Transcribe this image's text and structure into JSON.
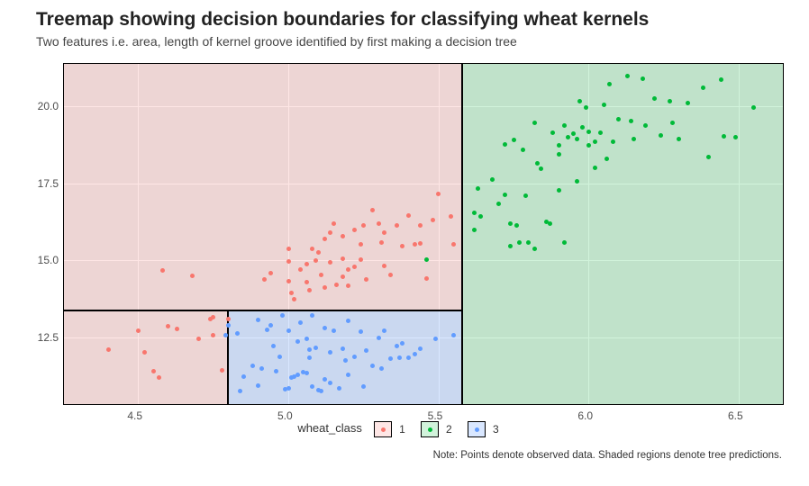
{
  "chart_data": {
    "type": "scatter",
    "title": "Treemap showing decision boundaries for classifying wheat kernels",
    "subtitle": "Two features i.e. area, length of kernel groove identified by first making a decision tree",
    "xlabel": "",
    "ylabel": "",
    "legend_title": "wheat_class",
    "legend_items": [
      "1",
      "2",
      "3"
    ],
    "caption": "Note: Points denote observed data. Shaded regions denote tree predictions.",
    "xlim": [
      4.25,
      6.65
    ],
    "ylim": [
      10.3,
      21.4
    ],
    "xticks": [
      4.5,
      5.0,
      5.5,
      6.0,
      6.5
    ],
    "yticks": [
      12.5,
      15.0,
      17.5,
      20.0
    ],
    "regions": [
      {
        "class": 2,
        "xmin": 5.58,
        "xmax": 6.65,
        "ymin": 10.3,
        "ymax": 21.4
      },
      {
        "class": 1,
        "xmin": 4.25,
        "xmax": 5.58,
        "ymin": 13.38,
        "ymax": 21.4
      },
      {
        "class": 1,
        "xmin": 4.25,
        "xmax": 4.8,
        "ymin": 10.3,
        "ymax": 13.38
      },
      {
        "class": 3,
        "xmin": 4.8,
        "xmax": 5.58,
        "ymin": 10.3,
        "ymax": 13.38
      }
    ],
    "series": [
      {
        "name": "1",
        "class": 1,
        "points": [
          [
            4.4,
            12.1
          ],
          [
            4.52,
            12.0
          ],
          [
            4.55,
            11.41
          ],
          [
            4.5,
            12.7
          ],
          [
            4.57,
            11.2
          ],
          [
            4.6,
            12.85
          ],
          [
            4.63,
            12.78
          ],
          [
            4.7,
            12.45
          ],
          [
            4.74,
            13.1
          ],
          [
            4.75,
            12.55
          ],
          [
            4.75,
            13.15
          ],
          [
            4.58,
            14.66
          ],
          [
            4.68,
            14.49
          ],
          [
            4.8,
            13.1
          ],
          [
            4.78,
            11.42
          ],
          [
            4.92,
            14.38
          ],
          [
            4.94,
            14.57
          ],
          [
            5.0,
            14.95
          ],
          [
            5.0,
            14.33
          ],
          [
            5.0,
            15.36
          ],
          [
            5.01,
            13.94
          ],
          [
            5.02,
            13.74
          ],
          [
            5.04,
            14.7
          ],
          [
            5.06,
            14.88
          ],
          [
            5.06,
            14.29
          ],
          [
            5.07,
            14.03
          ],
          [
            5.08,
            15.38
          ],
          [
            5.09,
            14.99
          ],
          [
            5.1,
            15.26
          ],
          [
            5.11,
            14.52
          ],
          [
            5.12,
            14.11
          ],
          [
            5.12,
            15.69
          ],
          [
            5.14,
            15.88
          ],
          [
            5.14,
            14.92
          ],
          [
            5.15,
            16.19
          ],
          [
            5.16,
            14.21
          ],
          [
            5.18,
            15.78
          ],
          [
            5.18,
            15.05
          ],
          [
            5.18,
            14.46
          ],
          [
            5.2,
            14.16
          ],
          [
            5.2,
            14.69
          ],
          [
            5.22,
            15.99
          ],
          [
            5.22,
            14.79
          ],
          [
            5.24,
            15.51
          ],
          [
            5.24,
            15.01
          ],
          [
            5.25,
            16.12
          ],
          [
            5.26,
            14.38
          ],
          [
            5.28,
            16.63
          ],
          [
            5.3,
            16.2
          ],
          [
            5.31,
            15.56
          ],
          [
            5.32,
            14.8
          ],
          [
            5.32,
            15.9
          ],
          [
            5.34,
            14.52
          ],
          [
            5.36,
            16.14
          ],
          [
            5.38,
            15.46
          ],
          [
            5.4,
            16.44
          ],
          [
            5.42,
            15.5
          ],
          [
            5.44,
            16.12
          ],
          [
            5.44,
            15.55
          ],
          [
            5.46,
            14.4
          ],
          [
            5.48,
            16.31
          ],
          [
            5.5,
            17.14
          ],
          [
            5.54,
            16.41
          ],
          [
            5.55,
            15.5
          ]
        ]
      },
      {
        "name": "2",
        "class": 2,
        "points": [
          [
            5.46,
            15.03
          ],
          [
            5.62,
            16.53
          ],
          [
            5.64,
            16.41
          ],
          [
            5.62,
            15.99
          ],
          [
            5.63,
            17.32
          ],
          [
            5.68,
            17.63
          ],
          [
            5.7,
            16.82
          ],
          [
            5.72,
            18.76
          ],
          [
            5.72,
            17.12
          ],
          [
            5.74,
            15.46
          ],
          [
            5.74,
            16.2
          ],
          [
            5.75,
            18.89
          ],
          [
            5.76,
            16.12
          ],
          [
            5.77,
            15.56
          ],
          [
            5.78,
            18.59
          ],
          [
            5.79,
            17.08
          ],
          [
            5.8,
            15.57
          ],
          [
            5.82,
            15.38
          ],
          [
            5.82,
            19.46
          ],
          [
            5.83,
            18.14
          ],
          [
            5.84,
            17.98
          ],
          [
            5.86,
            16.23
          ],
          [
            5.87,
            16.19
          ],
          [
            5.88,
            19.14
          ],
          [
            5.9,
            18.72
          ],
          [
            5.9,
            18.43
          ],
          [
            5.9,
            17.26
          ],
          [
            5.92,
            19.38
          ],
          [
            5.92,
            15.56
          ],
          [
            5.93,
            18.98
          ],
          [
            5.95,
            19.11
          ],
          [
            5.96,
            17.55
          ],
          [
            5.96,
            18.94
          ],
          [
            5.97,
            20.16
          ],
          [
            5.98,
            19.31
          ],
          [
            5.99,
            19.94
          ],
          [
            6.0,
            19.18
          ],
          [
            6.0,
            18.72
          ],
          [
            6.02,
            18.85
          ],
          [
            6.02,
            17.99
          ],
          [
            6.04,
            19.13
          ],
          [
            6.05,
            20.03
          ],
          [
            6.06,
            18.3
          ],
          [
            6.07,
            20.71
          ],
          [
            6.08,
            18.83
          ],
          [
            6.1,
            19.57
          ],
          [
            6.13,
            20.97
          ],
          [
            6.14,
            19.51
          ],
          [
            6.15,
            18.94
          ],
          [
            6.18,
            20.88
          ],
          [
            6.19,
            19.37
          ],
          [
            6.22,
            20.24
          ],
          [
            6.24,
            19.06
          ],
          [
            6.27,
            20.16
          ],
          [
            6.28,
            19.46
          ],
          [
            6.3,
            18.94
          ],
          [
            6.33,
            20.1
          ],
          [
            6.38,
            20.61
          ],
          [
            6.4,
            18.36
          ],
          [
            6.44,
            20.85
          ],
          [
            6.45,
            19.02
          ],
          [
            6.49,
            18.98
          ],
          [
            6.55,
            19.94
          ]
        ]
      },
      {
        "name": "3",
        "class": 3,
        "points": [
          [
            4.79,
            12.57
          ],
          [
            4.8,
            12.88
          ],
          [
            4.83,
            12.62
          ],
          [
            4.84,
            10.74
          ],
          [
            4.85,
            11.23
          ],
          [
            4.88,
            11.56
          ],
          [
            4.9,
            10.93
          ],
          [
            4.9,
            13.07
          ],
          [
            4.91,
            11.49
          ],
          [
            4.93,
            12.73
          ],
          [
            4.94,
            12.88
          ],
          [
            4.95,
            12.22
          ],
          [
            4.96,
            11.41
          ],
          [
            4.97,
            11.87
          ],
          [
            4.98,
            13.2
          ],
          [
            4.99,
            10.8
          ],
          [
            5.0,
            10.83
          ],
          [
            5.0,
            12.7
          ],
          [
            5.01,
            11.18
          ],
          [
            5.02,
            11.21
          ],
          [
            5.03,
            11.27
          ],
          [
            5.03,
            12.37
          ],
          [
            5.04,
            12.97
          ],
          [
            5.05,
            11.36
          ],
          [
            5.06,
            12.46
          ],
          [
            5.06,
            11.35
          ],
          [
            5.07,
            11.82
          ],
          [
            5.07,
            12.11
          ],
          [
            5.08,
            10.91
          ],
          [
            5.08,
            13.22
          ],
          [
            5.09,
            12.15
          ],
          [
            5.1,
            10.79
          ],
          [
            5.11,
            10.74
          ],
          [
            5.12,
            11.14
          ],
          [
            5.12,
            12.8
          ],
          [
            5.14,
            12.01
          ],
          [
            5.14,
            11.02
          ],
          [
            5.15,
            12.72
          ],
          [
            5.17,
            10.83
          ],
          [
            5.18,
            12.13
          ],
          [
            5.19,
            11.75
          ],
          [
            5.2,
            13.02
          ],
          [
            5.2,
            11.27
          ],
          [
            5.22,
            11.87
          ],
          [
            5.24,
            12.67
          ],
          [
            5.25,
            10.91
          ],
          [
            5.26,
            12.08
          ],
          [
            5.28,
            11.56
          ],
          [
            5.3,
            12.49
          ],
          [
            5.31,
            11.48
          ],
          [
            5.32,
            12.72
          ],
          [
            5.34,
            11.81
          ],
          [
            5.36,
            12.22
          ],
          [
            5.37,
            11.84
          ],
          [
            5.38,
            12.3
          ],
          [
            5.4,
            11.82
          ],
          [
            5.42,
            11.96
          ],
          [
            5.44,
            12.13
          ],
          [
            5.49,
            12.46
          ],
          [
            5.55,
            12.57
          ]
        ]
      }
    ]
  }
}
